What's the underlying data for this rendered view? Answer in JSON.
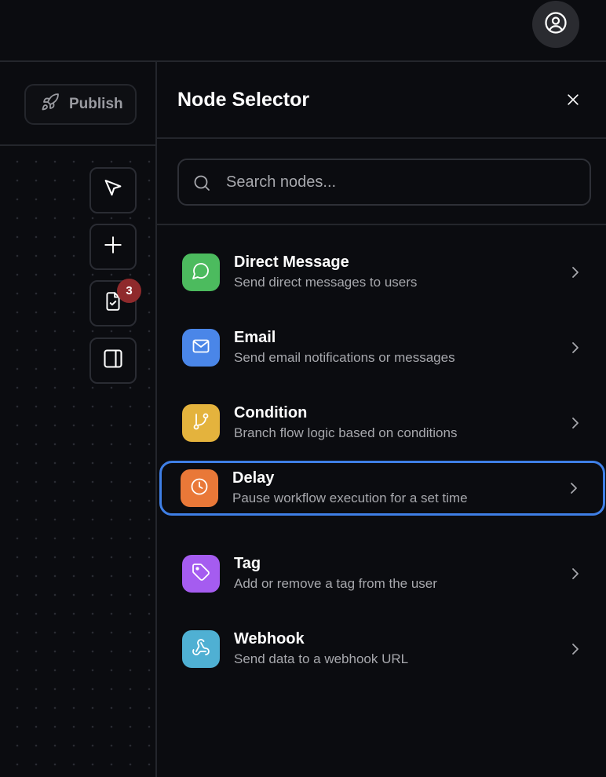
{
  "canvas": {
    "publish_label": "Publish",
    "tools": {
      "tasks_badge": "3"
    }
  },
  "panel": {
    "title": "Node Selector",
    "search": {
      "placeholder": "Search nodes..."
    },
    "nodes": [
      {
        "title": "Direct Message",
        "description": "Send direct messages to users",
        "color": "#4cbb5e"
      },
      {
        "title": "Email",
        "description": "Send email notifications or messages",
        "color": "#4a86e8"
      },
      {
        "title": "Condition",
        "description": "Branch flow logic based on conditions",
        "color": "#e4b33d"
      },
      {
        "title": "Delay",
        "description": "Pause workflow execution for a set time",
        "color": "#e97838",
        "selected": true
      },
      {
        "title": "Tag",
        "description": "Add or remove a tag from the user",
        "color": "#a55cf0"
      },
      {
        "title": "Webhook",
        "description": "Send data to a webhook URL",
        "color": "#4fb0d3"
      }
    ]
  },
  "icons": {
    "user": "user-circle-icon",
    "publish": "rocket-icon",
    "pointer": "pointer-icon",
    "add": "plus-icon",
    "tasks": "clipboard-check-icon",
    "panel": "panel-toggle-icon",
    "close": "close-icon",
    "search": "search-icon",
    "direct_message": "chat-bubble-icon",
    "email": "mail-icon",
    "condition": "git-branch-icon",
    "delay": "clock-icon",
    "tag": "tag-icon",
    "webhook": "webhook-icon",
    "chevron": "chevron-right-icon"
  },
  "colors": {
    "background": "#0b0c10",
    "border": "#24262c",
    "selected_outline": "#3f7fe6",
    "badge": "#8f2a2c"
  }
}
